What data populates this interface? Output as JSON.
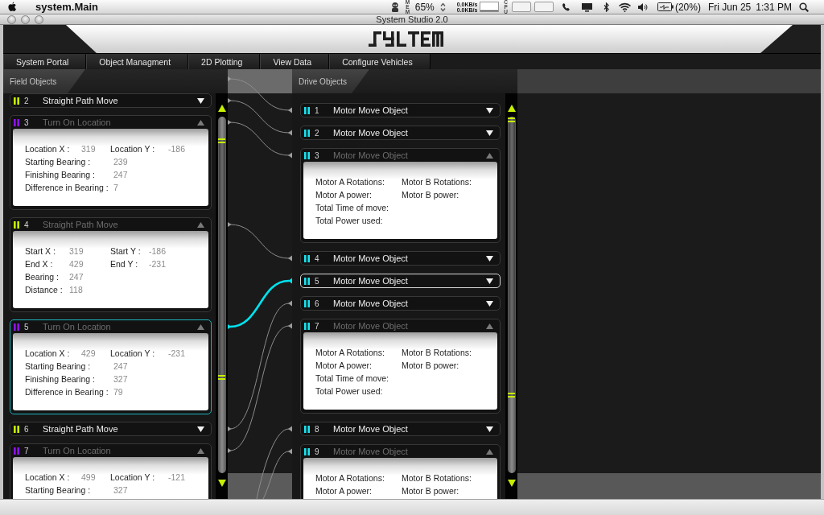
{
  "menu_bar": {
    "app_name": "system.Main",
    "memory_label": "MEM",
    "percent_reading": "65%",
    "network_rates": [
      "0.0KB/s",
      "0.0KB/s"
    ],
    "cpu_label": "CPU",
    "battery_reading": "(20%)",
    "date": "Fri Jun 25",
    "time": "1:31 PM"
  },
  "window": {
    "title": "System Studio 2.0"
  },
  "nav_tabs": [
    "System Portal",
    "Object Managment",
    "2D Plotting",
    "View Data",
    "Configure Vehicles"
  ],
  "field_objects": {
    "title": "Field Objects",
    "items": [
      {
        "number": "2",
        "name": "Straight Path Move",
        "kind": "straight",
        "color": "#c6f000",
        "expanded": false,
        "selected": false
      },
      {
        "number": "3",
        "name": "Turn On Location",
        "kind": "turn",
        "color": "#8c14e6",
        "expanded": true,
        "selected": false,
        "rows": [
          {
            "cells": [
              {
                "label": "Location X :",
                "value": "319"
              },
              {
                "label": "Location Y :",
                "value": "-186"
              }
            ]
          },
          {
            "cells": [
              {
                "label": "Starting Bearing :",
                "value": "239"
              }
            ]
          },
          {
            "cells": [
              {
                "label": "Finishing Bearing :",
                "value": "247"
              }
            ]
          },
          {
            "cells": [
              {
                "label": "Difference in Bearing :",
                "value": "7"
              }
            ]
          }
        ]
      },
      {
        "number": "4",
        "name": "Straight Path Move",
        "kind": "straight",
        "color": "#c6f000",
        "expanded": true,
        "selected": false,
        "rows": [
          {
            "cells": [
              {
                "label": "Start X :",
                "value": "319"
              },
              {
                "label": "Start Y :",
                "value": "-186"
              }
            ]
          },
          {
            "cells": [
              {
                "label": "End X :",
                "value": "429"
              },
              {
                "label": "End Y :",
                "value": "-231"
              }
            ]
          },
          {
            "cells": [
              {
                "label": "Bearing :",
                "value": "247"
              }
            ]
          },
          {
            "cells": [
              {
                "label": "Distance :",
                "value": "118"
              }
            ]
          }
        ]
      },
      {
        "number": "5",
        "name": "Turn On Location",
        "kind": "turn",
        "color": "#8c14e6",
        "expanded": true,
        "selected": true,
        "rows": [
          {
            "cells": [
              {
                "label": "Location X :",
                "value": "429"
              },
              {
                "label": "Location Y :",
                "value": "-231"
              }
            ]
          },
          {
            "cells": [
              {
                "label": "Starting Bearing :",
                "value": "247"
              }
            ]
          },
          {
            "cells": [
              {
                "label": "Finishing Bearing :",
                "value": "327"
              }
            ]
          },
          {
            "cells": [
              {
                "label": "Difference in Bearing :",
                "value": "79"
              }
            ]
          }
        ]
      },
      {
        "number": "6",
        "name": "Straight Path Move",
        "kind": "straight",
        "color": "#c6f000",
        "expanded": false,
        "selected": false
      },
      {
        "number": "7",
        "name": "Turn On Location",
        "kind": "turn",
        "color": "#8c14e6",
        "expanded": true,
        "selected": false,
        "rows": [
          {
            "cells": [
              {
                "label": "Location X :",
                "value": "499"
              },
              {
                "label": "Location Y :",
                "value": "-121"
              }
            ]
          },
          {
            "cells": [
              {
                "label": "Starting Bearing :",
                "value": "327"
              }
            ]
          }
        ]
      }
    ]
  },
  "drive_objects": {
    "title": "Drive Objects",
    "items": [
      {
        "number": "1",
        "name": "Motor Move Object",
        "kind": "motor",
        "color": "#19e3f0",
        "expanded": false,
        "selected": false
      },
      {
        "number": "2",
        "name": "Motor Move Object",
        "kind": "motor",
        "color": "#19e3f0",
        "expanded": false,
        "selected": false
      },
      {
        "number": "3",
        "name": "Motor Move Object",
        "kind": "motor",
        "color": "#19e3f0",
        "expanded": true,
        "selected": false,
        "rows": [
          {
            "cells": [
              {
                "label": "Motor A Rotations:"
              },
              {
                "label": "Motor B Rotations:"
              }
            ]
          },
          {
            "cells": [
              {
                "label": "Motor A power:"
              },
              {
                "label": "Motor B power:"
              }
            ]
          },
          {
            "cells": [
              {
                "label": "Total Time of move:"
              }
            ]
          },
          {
            "cells": [
              {
                "label": "Total Power used:"
              }
            ]
          }
        ]
      },
      {
        "number": "4",
        "name": "Motor Move Object",
        "kind": "motor",
        "color": "#19e3f0",
        "expanded": false,
        "selected": false
      },
      {
        "number": "5",
        "name": "Motor Move Object",
        "kind": "motor",
        "color": "#19e3f0",
        "expanded": false,
        "selected": true
      },
      {
        "number": "6",
        "name": "Motor Move Object",
        "kind": "motor",
        "color": "#19e3f0",
        "expanded": false,
        "selected": false
      },
      {
        "number": "7",
        "name": "Motor Move Object",
        "kind": "motor",
        "color": "#19e3f0",
        "expanded": true,
        "selected": false,
        "rows": [
          {
            "cells": [
              {
                "label": "Motor A Rotations:"
              },
              {
                "label": "Motor B Rotations:"
              }
            ]
          },
          {
            "cells": [
              {
                "label": "Motor A power:"
              },
              {
                "label": "Motor B power:"
              }
            ]
          },
          {
            "cells": [
              {
                "label": "Total Time of move:"
              }
            ]
          },
          {
            "cells": [
              {
                "label": "Total Power used:"
              }
            ]
          }
        ]
      },
      {
        "number": "8",
        "name": "Motor Move Object",
        "kind": "motor",
        "color": "#19e3f0",
        "expanded": false,
        "selected": false
      },
      {
        "number": "9",
        "name": "Motor Move Object",
        "kind": "motor",
        "color": "#19e3f0",
        "expanded": true,
        "selected": false,
        "rows": [
          {
            "cells": [
              {
                "label": "Motor A Rotations:"
              },
              {
                "label": "Motor B Rotations:"
              }
            ]
          },
          {
            "cells": [
              {
                "label": "Motor A power:"
              },
              {
                "label": "Motor B power:"
              }
            ]
          }
        ]
      }
    ]
  }
}
